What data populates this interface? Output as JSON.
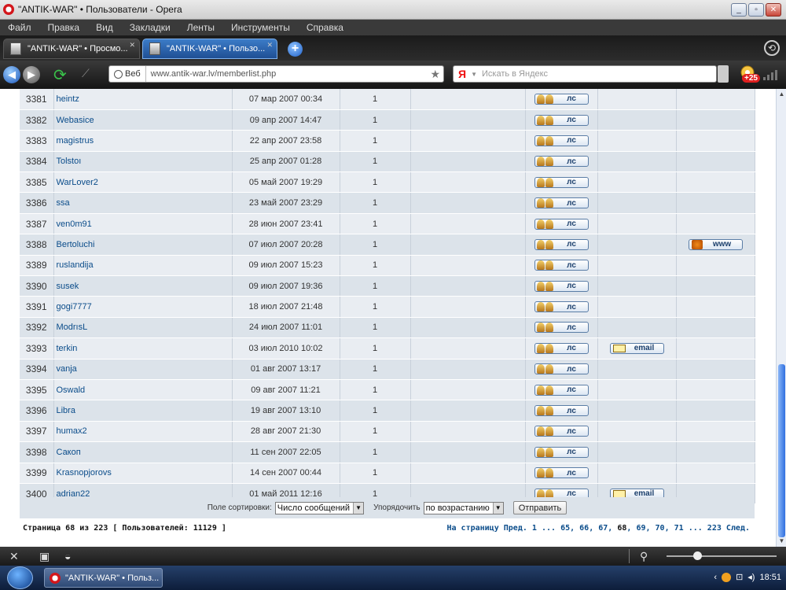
{
  "window": {
    "title": "\"ANTIK-WAR\" • Пользователи - Opera"
  },
  "menu": [
    "Файл",
    "Правка",
    "Вид",
    "Закладки",
    "Ленты",
    "Инструменты",
    "Справка"
  ],
  "tabs": [
    {
      "label": "\"ANTIK-WAR\" • Просмо..."
    },
    {
      "label": "\"ANTIK-WAR\" • Пользо..."
    }
  ],
  "address": {
    "badge": "Веб",
    "url": "www.antik-war.lv/memberlist.php"
  },
  "search": {
    "engine": "Я",
    "placeholder": "Искать в Яндекс"
  },
  "mail_badge": "+25",
  "members": [
    {
      "num": "3381",
      "name": "heintz",
      "date": "07 мар 2007 00:34",
      "posts": "1",
      "email": "",
      "www": ""
    },
    {
      "num": "3382",
      "name": "Webasice",
      "date": "09 апр 2007 14:47",
      "posts": "1",
      "email": "",
      "www": ""
    },
    {
      "num": "3383",
      "name": "magistrus",
      "date": "22 апр 2007 23:58",
      "posts": "1",
      "email": "",
      "www": ""
    },
    {
      "num": "3384",
      "name": "Tolstoı",
      "date": "25 апр 2007 01:28",
      "posts": "1",
      "email": "",
      "www": ""
    },
    {
      "num": "3385",
      "name": "WarLover2",
      "date": "05 май 2007 19:29",
      "posts": "1",
      "email": "",
      "www": ""
    },
    {
      "num": "3386",
      "name": "ssa",
      "date": "23 май 2007 23:29",
      "posts": "1",
      "email": "",
      "www": ""
    },
    {
      "num": "3387",
      "name": "ven0m91",
      "date": "28 июн 2007 23:41",
      "posts": "1",
      "email": "",
      "www": ""
    },
    {
      "num": "3388",
      "name": "Bertoluchi",
      "date": "07 июл 2007 20:28",
      "posts": "1",
      "email": "",
      "www": "www"
    },
    {
      "num": "3389",
      "name": "ruslandija",
      "date": "09 июл 2007 15:23",
      "posts": "1",
      "email": "",
      "www": ""
    },
    {
      "num": "3390",
      "name": "susek",
      "date": "09 июл 2007 19:36",
      "posts": "1",
      "email": "",
      "www": ""
    },
    {
      "num": "3391",
      "name": "gogi7777",
      "date": "18 июл 2007 21:48",
      "posts": "1",
      "email": "",
      "www": ""
    },
    {
      "num": "3392",
      "name": "ModrısL",
      "date": "24 июл 2007 11:01",
      "posts": "1",
      "email": "",
      "www": ""
    },
    {
      "num": "3393",
      "name": "terkin",
      "date": "03 июл 2010 10:02",
      "posts": "1",
      "email": "email",
      "www": ""
    },
    {
      "num": "3394",
      "name": "vanja",
      "date": "01 авг 2007 13:17",
      "posts": "1",
      "email": "",
      "www": ""
    },
    {
      "num": "3395",
      "name": "Oswald",
      "date": "09 авг 2007 11:21",
      "posts": "1",
      "email": "",
      "www": ""
    },
    {
      "num": "3396",
      "name": "Libra",
      "date": "19 авг 2007 13:10",
      "posts": "1",
      "email": "",
      "www": ""
    },
    {
      "num": "3397",
      "name": "humax2",
      "date": "28 авг 2007 21:30",
      "posts": "1",
      "email": "",
      "www": ""
    },
    {
      "num": "3398",
      "name": "Сакоп",
      "date": "11 сен 2007 22:05",
      "posts": "1",
      "email": "",
      "www": ""
    },
    {
      "num": "3399",
      "name": "Krasnopjorovs",
      "date": "14 сен 2007 00:44",
      "posts": "1",
      "email": "",
      "www": ""
    },
    {
      "num": "3400",
      "name": "adrian22",
      "date": "01 май 2011 12:16",
      "posts": "1",
      "email": "email",
      "www": ""
    }
  ],
  "pm_label": "лс",
  "sort": {
    "field_label": "Поле сортировки:",
    "field_value": "Число сообщений",
    "order_label": "Упорядочить",
    "order_value": "по возрастанию",
    "submit": "Отправить"
  },
  "page_info": "Страница 68 из 223 [ Пользователей: 11129 ]",
  "pagination": {
    "prefix": "На страницу",
    "prev": "Пред.",
    "first": "1",
    "sep": "...",
    "pages": [
      "65",
      "66",
      "67",
      "68",
      "69",
      "70",
      "71"
    ],
    "current": "68",
    "last": "223",
    "next": "След."
  },
  "taskbar": {
    "task_label": "\"ANTIK-WAR\" • Польз...",
    "clock": "18:51"
  }
}
